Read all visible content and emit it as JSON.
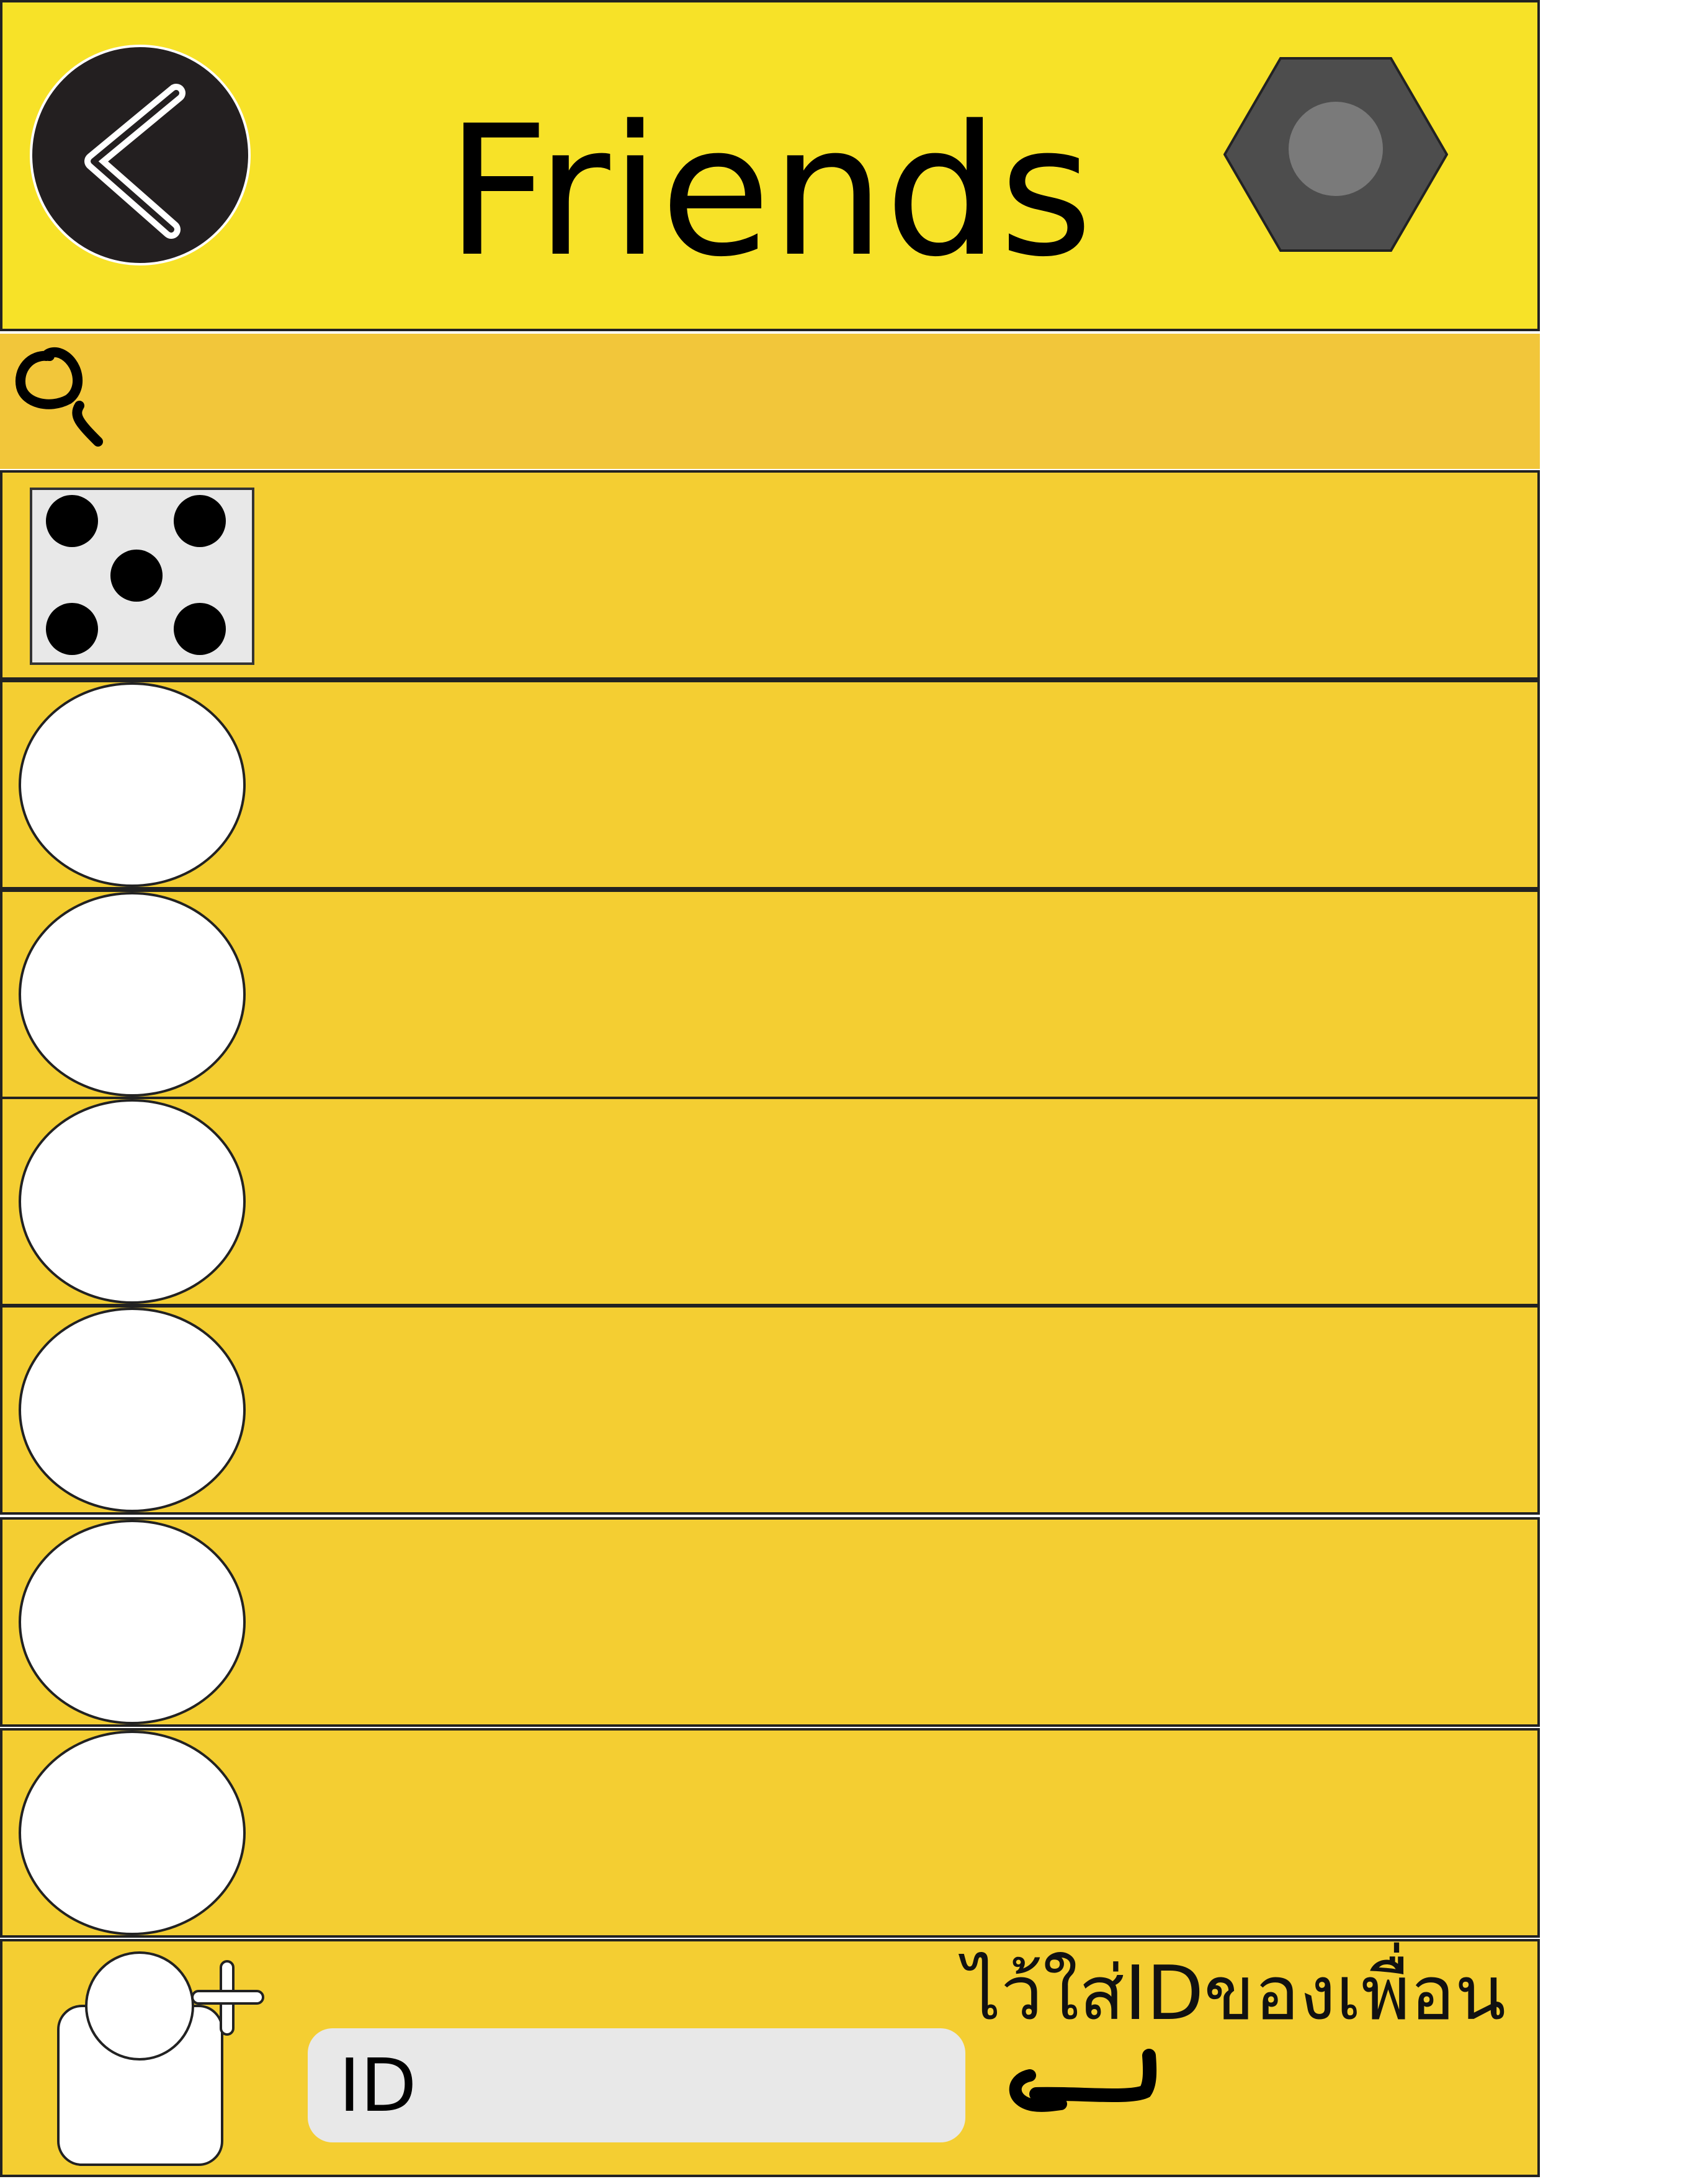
{
  "header": {
    "title": "Friends",
    "back_icon": "chevron-left-icon",
    "settings_icon": "hexagon-settings-icon",
    "background_color": "#f7e228"
  },
  "search": {
    "icon": "search-icon",
    "background_color": "#f2c63a"
  },
  "friends": {
    "row_color": "#f4ce32",
    "rows": [
      {
        "avatar_type": "dice-five"
      },
      {
        "avatar_type": "circle"
      },
      {
        "avatar_type": "circle"
      },
      {
        "avatar_type": "circle"
      },
      {
        "avatar_type": "circle"
      },
      {
        "avatar_type": "circle"
      },
      {
        "avatar_type": "circle"
      }
    ]
  },
  "footer": {
    "add_friend_icon": "add-user-icon",
    "id_input_placeholder": "ID",
    "hint": "ไว้ใส่IDของเพื่อน",
    "hint_arrow_icon": "curved-arrow-left-icon"
  }
}
